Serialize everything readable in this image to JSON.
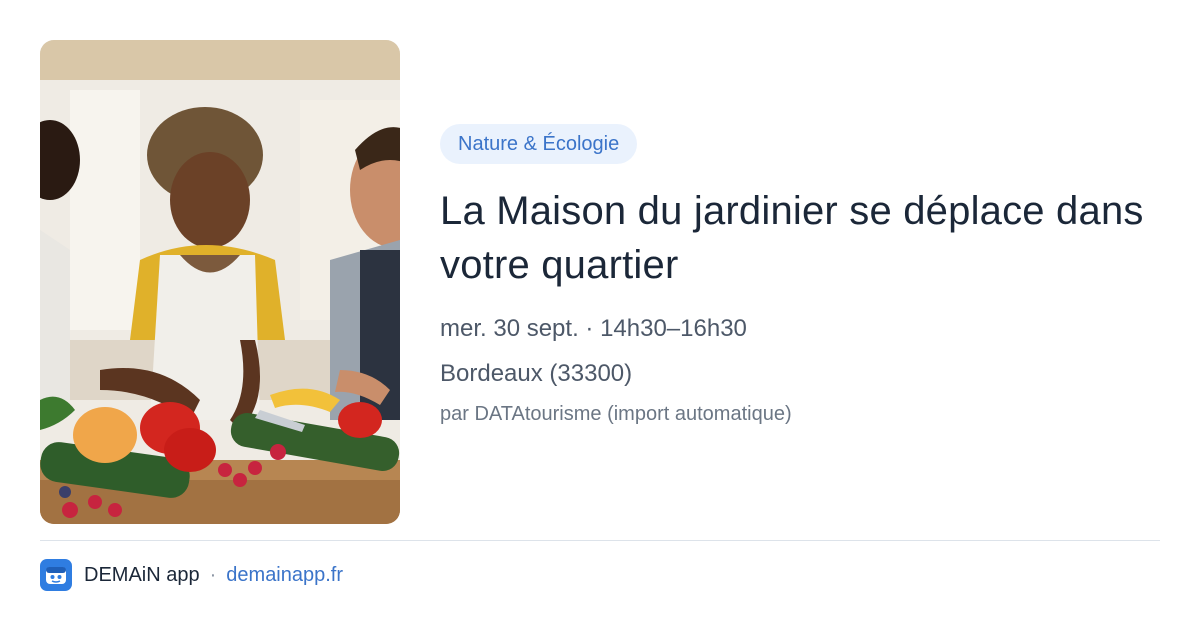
{
  "event": {
    "category": "Nature & Écologie",
    "title": "La Maison du jardinier se déplace dans votre quartier",
    "date_time": "mer. 30 sept. · 14h30–16h30",
    "location": "Bordeaux (33300)",
    "source": "par DATAtourisme (import automatique)",
    "image_icon": "photo-people-cooking-vegetables"
  },
  "footer": {
    "app_name": "DEMAiN app",
    "separator": "·",
    "domain": "demainapp.fr",
    "logo_icon": "demain-app-logo-icon"
  },
  "colors": {
    "accent": "#3b74c9",
    "badge_background": "#eaf2fd",
    "logo_background": "#2f7de1"
  }
}
